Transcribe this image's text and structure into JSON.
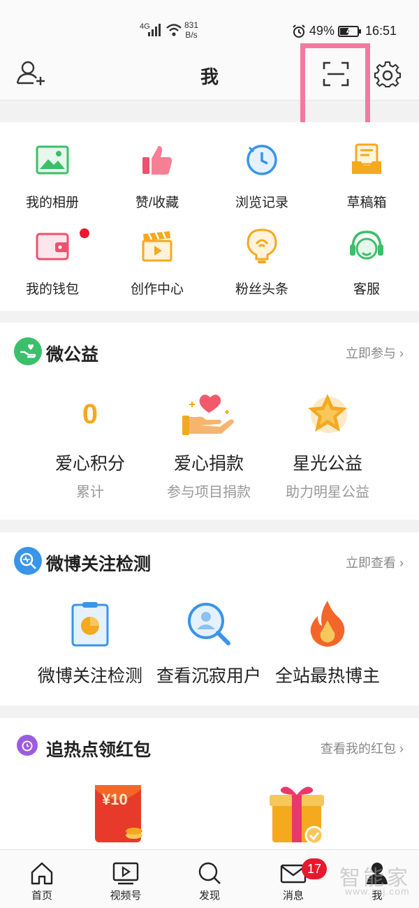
{
  "status_bar": {
    "network": "4G",
    "speed_value": "831",
    "speed_unit": "B/s",
    "battery": "49%",
    "time": "16:51"
  },
  "header": {
    "title": "我",
    "add_friend_icon": "add-user-icon",
    "scan_icon": "scan-icon",
    "settings_icon": "gear-icon",
    "highlight_color": "#f07ba1"
  },
  "quick_actions": [
    {
      "label": "我的相册",
      "icon": "album-icon",
      "color": "#3cbf6a"
    },
    {
      "label": "赞/收藏",
      "icon": "thumbs-up-icon",
      "color": "#f0506e"
    },
    {
      "label": "浏览记录",
      "icon": "history-clock-icon",
      "color": "#3a94e8"
    },
    {
      "label": "草稿箱",
      "icon": "drafts-box-icon",
      "color": "#f4a91f"
    },
    {
      "label": "我的钱包",
      "icon": "wallet-icon",
      "color": "#f0506e",
      "has_dot": true
    },
    {
      "label": "创作中心",
      "icon": "clapperboard-icon",
      "color": "#f4a91f"
    },
    {
      "label": "粉丝头条",
      "icon": "bulb-icon",
      "color": "#f4a91f"
    },
    {
      "label": "客服",
      "icon": "headset-icon",
      "color": "#3cbf6a"
    }
  ],
  "charity": {
    "title": "微公益",
    "link": "立即参与",
    "items": [
      {
        "value": "0",
        "title": "爱心积分",
        "subtitle": "累计"
      },
      {
        "title": "爱心捐款",
        "subtitle": "参与项目捐款",
        "icon": "heart-hand-icon"
      },
      {
        "title": "星光公益",
        "subtitle": "助力明星公益",
        "icon": "star-badge-icon"
      }
    ]
  },
  "detection": {
    "title": "微博关注检测",
    "link": "立即查看",
    "items": [
      {
        "label": "微博关注检测",
        "icon": "clipboard-chart-icon"
      },
      {
        "label": "查看沉寂用户",
        "icon": "user-search-icon"
      },
      {
        "label": "全站最热博主",
        "icon": "fire-icon"
      }
    ]
  },
  "red_packet": {
    "title": "追热点领红包",
    "link": "查看我的红包",
    "packet_amount": "¥10",
    "icons": [
      "red-packet-icon",
      "gift-box-icon"
    ]
  },
  "tabbar": {
    "tabs": [
      {
        "label": "首页",
        "icon": "home-icon"
      },
      {
        "label": "视频号",
        "icon": "video-icon"
      },
      {
        "label": "发现",
        "icon": "search-icon"
      },
      {
        "label": "消息",
        "icon": "mail-icon",
        "badge": "17"
      },
      {
        "label": "我",
        "icon": "profile-icon"
      }
    ]
  },
  "watermark": {
    "text": "智能家",
    "url": "www.znj.com"
  }
}
